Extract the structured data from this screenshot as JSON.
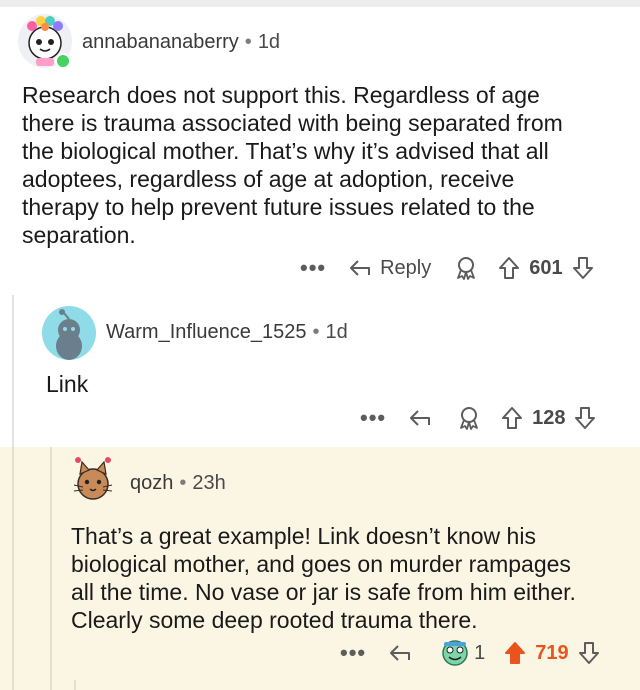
{
  "comments": [
    {
      "username": "annabananaberry",
      "age": "1d",
      "lines": [
        "Research does not support this. Regardless of age",
        "there is trauma associated with being separated from",
        "the biological mother. That’s why it’s advised that all",
        "adoptees, regardless of age at adoption, receive",
        "therapy to help prevent future issues related to the",
        "separation."
      ],
      "reply_label": "Reply",
      "score": "601"
    },
    {
      "username": "Warm_Influence_1525",
      "age": "1d",
      "lines": [
        "Link"
      ],
      "score": "128"
    },
    {
      "username": "qozh",
      "age": "23h",
      "lines": [
        "That’s a great example! Link doesn’t know his",
        "biological mother, and goes on murder rampages",
        "all the time. No vase or jar is safe from him either.",
        "Clearly some deep rooted trauma there."
      ],
      "award_count": "1",
      "score": "719"
    }
  ],
  "meta": {
    "separator": "•",
    "more_glyph": "•••"
  },
  "colors": {
    "highlight": "#fbf6e3",
    "upvoted": "#e8541c",
    "online": "#46d160"
  },
  "icons": [
    "more-icon",
    "reply-icon",
    "award-icon",
    "upvote-icon",
    "downvote-icon"
  ]
}
